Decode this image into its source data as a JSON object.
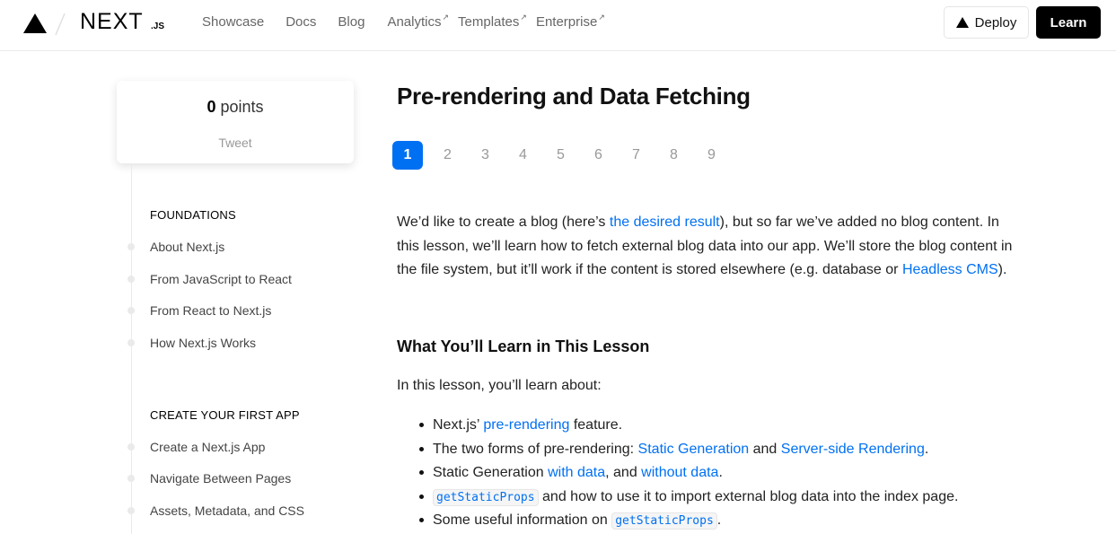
{
  "header": {
    "wordmark": "NEXT",
    "wordmark_suffix": ".JS",
    "nav": [
      {
        "label": "Showcase",
        "external": false
      },
      {
        "label": "Docs",
        "external": false
      },
      {
        "label": "Blog",
        "external": false
      },
      {
        "label": "Analytics",
        "external": true
      },
      {
        "label": "Templates",
        "external": true
      },
      {
        "label": "Enterprise",
        "external": true
      }
    ],
    "external_mark": "↗",
    "deploy_label": "Deploy",
    "learn_label": "Learn"
  },
  "points_card": {
    "value": "0",
    "unit": " points",
    "tweet_label": "Tweet"
  },
  "sidebar": {
    "sections": [
      {
        "title": "FOUNDATIONS",
        "items": [
          "About Next.js",
          "From JavaScript to React",
          "From React to Next.js",
          "How Next.js Works"
        ]
      },
      {
        "title": "CREATE YOUR FIRST APP",
        "items": [
          "Create a Next.js App",
          "Navigate Between Pages",
          "Assets, Metadata, and CSS"
        ]
      }
    ]
  },
  "main": {
    "title": "Pre-rendering and Data Fetching",
    "pages": [
      "1",
      "2",
      "3",
      "4",
      "5",
      "6",
      "7",
      "8",
      "9"
    ],
    "active_page": "1",
    "intro": {
      "t1": "We’d like to create a blog (here’s ",
      "l1": "the desired result",
      "t2": "), but so far we’ve added no blog content. In this lesson, we’ll learn how to fetch external blog data into our app. We’ll store the blog content in the file system, but it’ll work if the content is stored elsewhere (e.g. database or ",
      "l2": "Headless CMS",
      "t3": ")."
    },
    "subheading": "What You’ll Learn in This Lesson",
    "lead": "In this lesson, you’ll learn about:",
    "bullets": {
      "b1": {
        "t1": "Next.js’ ",
        "l1": "pre-rendering",
        "t2": " feature."
      },
      "b2": {
        "t1": "The two forms of pre-rendering: ",
        "l1": "Static Generation",
        "t2": " and ",
        "l2": "Server-side Rendering",
        "t3": "."
      },
      "b3": {
        "t1": "Static Generation ",
        "l1": "with data",
        "t2": ", and ",
        "l2": "without data",
        "t3": "."
      },
      "b4": {
        "code": "getStaticProps",
        "t1": " and how to use it to import external blog data into the index page."
      },
      "b5": {
        "t1": "Some useful information on ",
        "code": "getStaticProps",
        "t2": "."
      }
    }
  },
  "colors": {
    "accent": "#0070f3",
    "text": "#222222",
    "muted": "#666666",
    "border": "#eaeaea"
  }
}
